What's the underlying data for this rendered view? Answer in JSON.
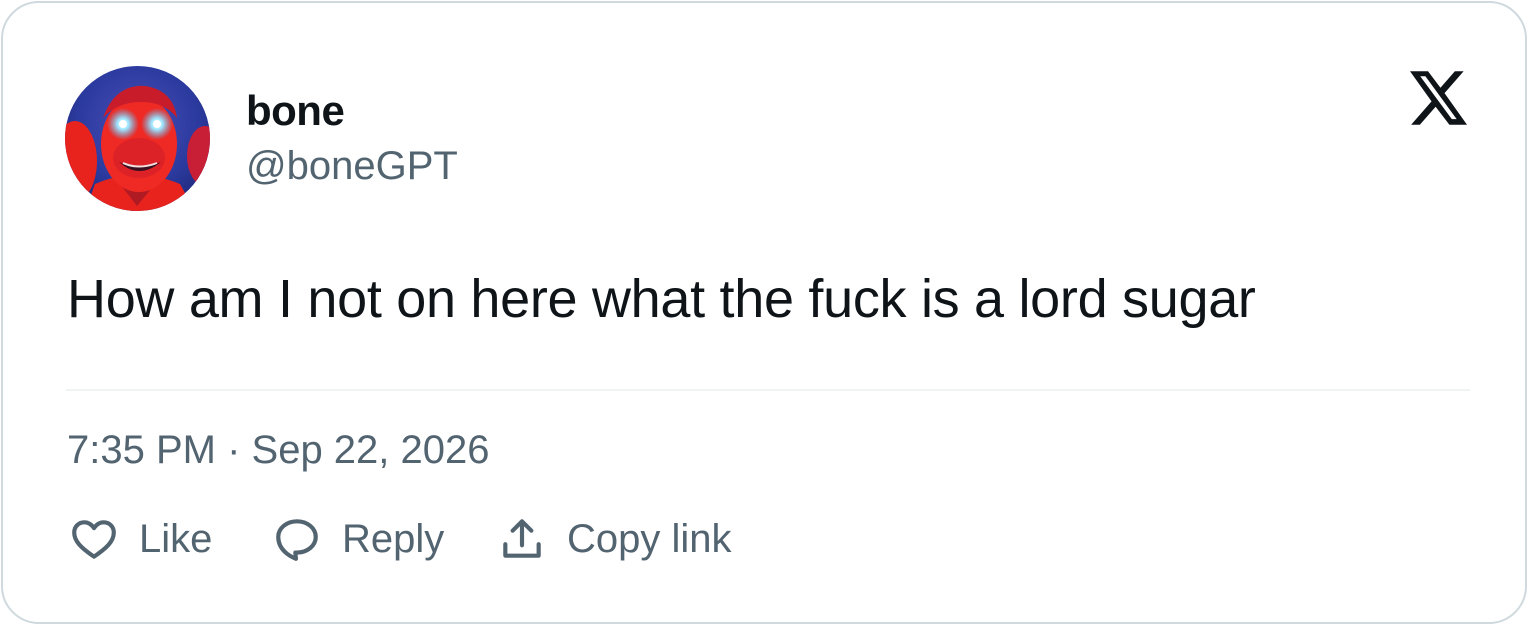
{
  "tweet": {
    "author": {
      "display_name": "bone",
      "handle": "@boneGPT"
    },
    "text": "How am I not on here what the fuck is a lord sugar",
    "timestamp": "7:35 PM · Sep 22, 2026"
  },
  "actions": {
    "like_label": "Like",
    "reply_label": "Reply",
    "copy_link_label": "Copy link"
  },
  "icons": {
    "platform": "x-logo-icon",
    "like": "heart-icon",
    "reply": "speech-bubble-icon",
    "copy_link": "share-upload-icon"
  },
  "colors": {
    "primary_text": "#0f1419",
    "secondary_text": "#536471",
    "border": "#cfd9de",
    "divider": "#eff3f4",
    "avatar_red": "#e8231e",
    "avatar_blue": "#2b3a9e",
    "avatar_glow": "#4fc3ff"
  }
}
